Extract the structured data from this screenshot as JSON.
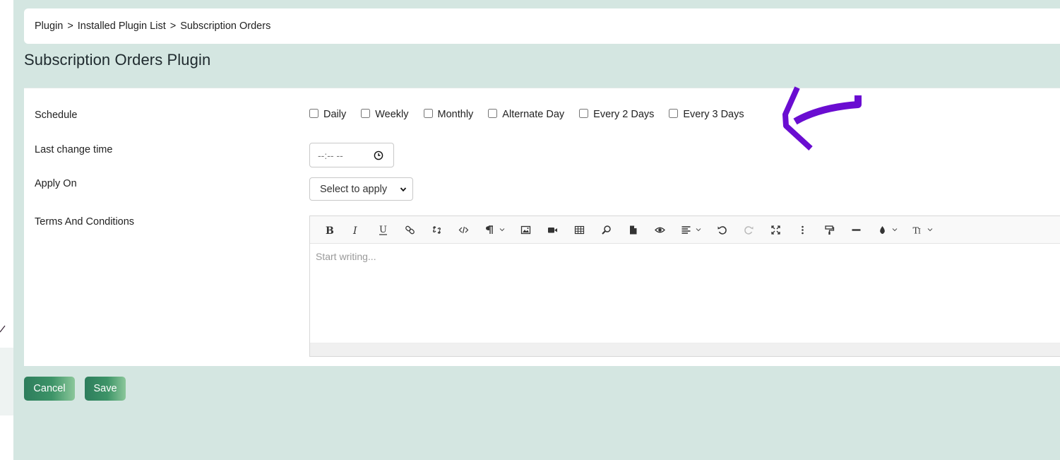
{
  "breadcrumb": {
    "items": [
      "Plugin",
      "Installed Plugin List",
      "Subscription Orders"
    ],
    "separator": ">"
  },
  "page": {
    "title": "Subscription Orders Plugin"
  },
  "form": {
    "schedule": {
      "label": "Schedule",
      "options": [
        {
          "label": "Daily",
          "checked": false
        },
        {
          "label": "Weekly",
          "checked": false
        },
        {
          "label": "Monthly",
          "checked": false
        },
        {
          "label": "Alternate Day",
          "checked": false
        },
        {
          "label": "Every 2 Days",
          "checked": false
        },
        {
          "label": "Every 3 Days",
          "checked": false
        }
      ]
    },
    "last_change_time": {
      "label": "Last change time",
      "value": "--:-- --",
      "icon": "clock-icon"
    },
    "apply_on": {
      "label": "Apply On",
      "selected": "Select to apply"
    },
    "terms": {
      "label": "Terms And Conditions",
      "placeholder": "Start writing...",
      "toolbar": [
        "bold-icon",
        "italic-icon",
        "underline-icon",
        "link-icon",
        "unlink-icon",
        "code-view-icon",
        "paragraph-icon",
        "image-icon",
        "video-icon",
        "table-icon",
        "find-icon",
        "template-icon",
        "preview-icon",
        "align-icon",
        "undo-icon",
        "redo-icon",
        "fullscreen-icon",
        "more-icon",
        "format-painter-icon",
        "horizontal-rule-icon",
        "text-color-icon",
        "font-size-icon"
      ]
    }
  },
  "actions": {
    "cancel_label": "Cancel",
    "save_label": "Save"
  },
  "colors": {
    "background": "#d4e6e1",
    "button_start": "#2d7d5c",
    "button_end": "#8bc79a",
    "annotation": "#6a0dd1"
  }
}
